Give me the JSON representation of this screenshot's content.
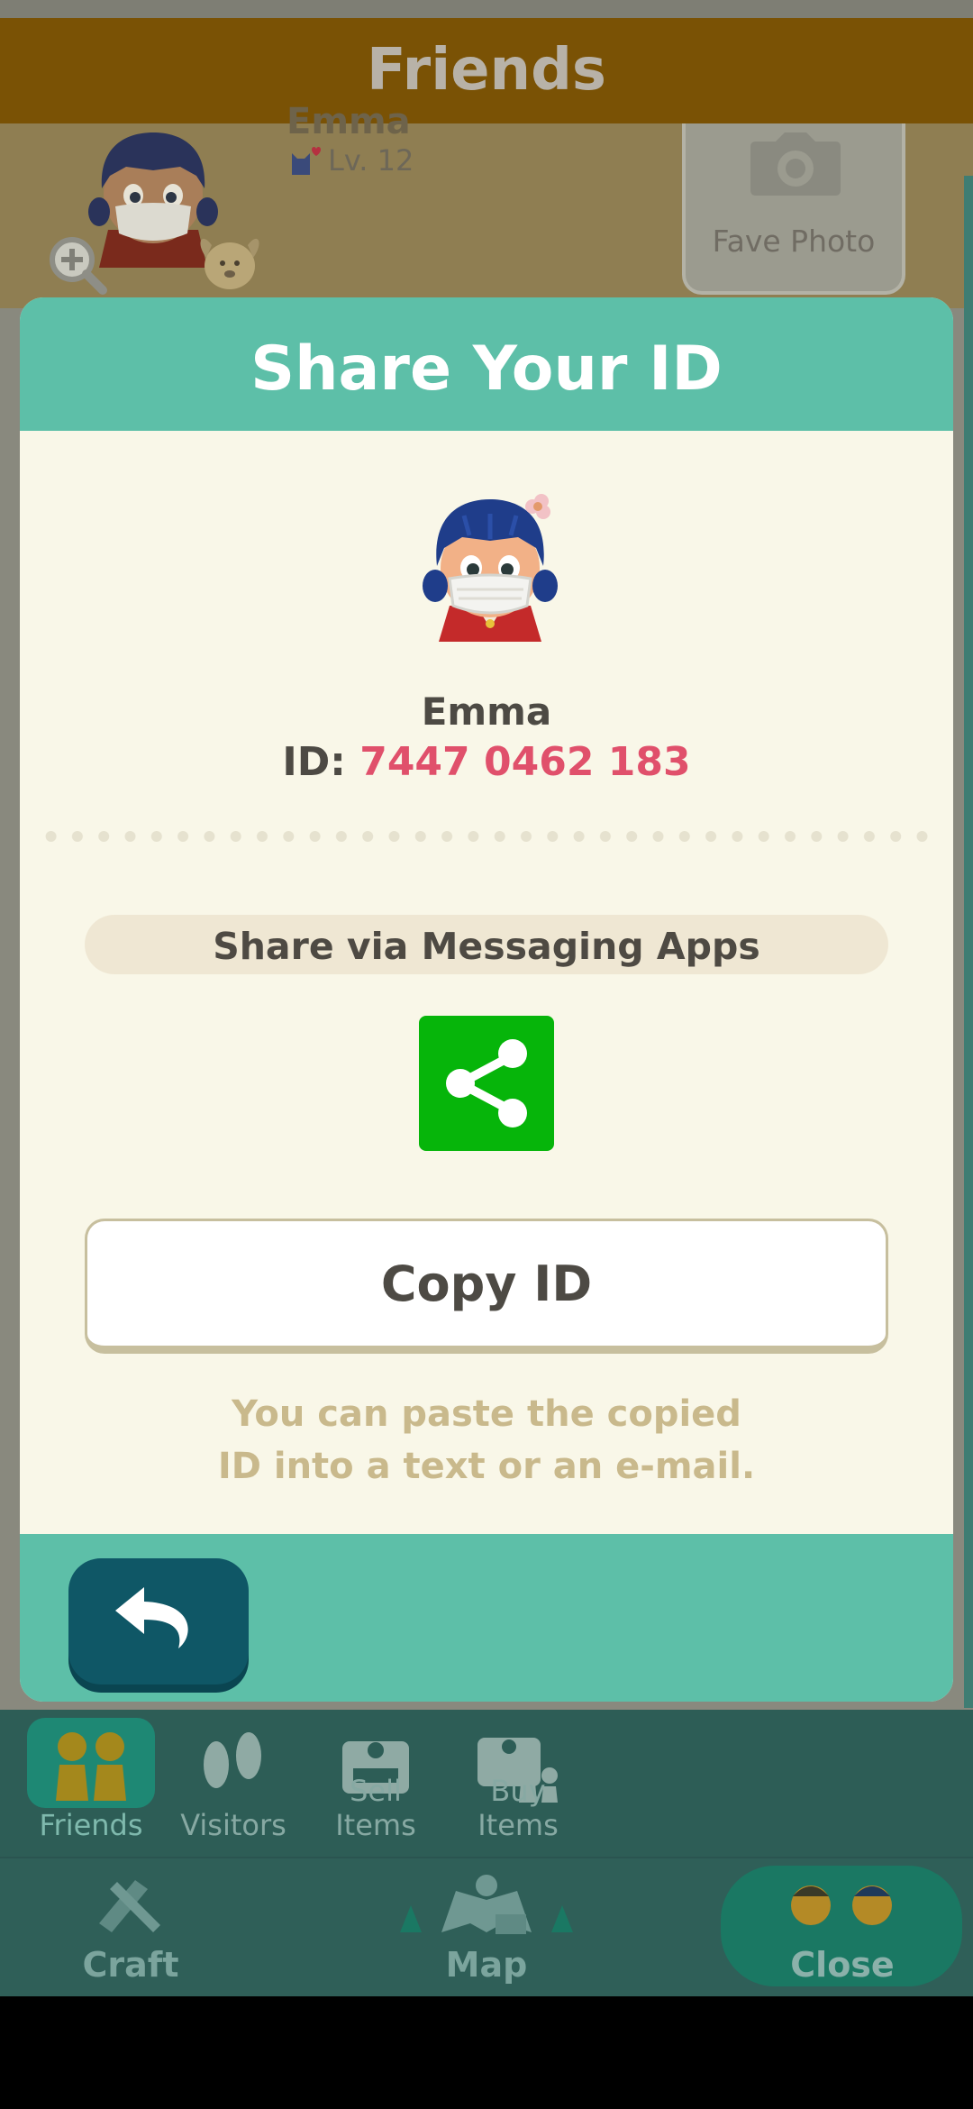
{
  "header": {
    "title": "Friends"
  },
  "profile": {
    "name": "Emma",
    "level": "Lv. 12",
    "fave_photo_label": "Fave Photo"
  },
  "modal": {
    "title": "Share Your ID",
    "user_name": "Emma",
    "id_prefix": "ID:",
    "id_value": "7447 0462 183",
    "share_label": "Share via Messaging Apps",
    "copy_label": "Copy ID",
    "hint_line1": "You can paste the copied",
    "hint_line2": "ID into a text or an e-mail."
  },
  "bottom_nav": {
    "row1": [
      {
        "label": "Friends",
        "icon": "friends-icon",
        "active": true
      },
      {
        "label": "Visitors",
        "icon": "footprints-icon",
        "active": false
      },
      {
        "label": "Sell Items",
        "icon": "sell-box-icon",
        "active": false
      },
      {
        "label": "Buy Items",
        "icon": "buy-box-icon",
        "active": false
      }
    ],
    "row2": [
      {
        "label": "Craft",
        "icon": "saw-hammer-icon"
      },
      {
        "label": "Map",
        "icon": "map-icon"
      },
      {
        "label": "Close",
        "icon": "villagers-icon"
      }
    ]
  },
  "colors": {
    "teal": "#5dbfa8",
    "cream": "#f9f7e8",
    "id_red": "#e0506b",
    "share_green": "#06b50a",
    "back_button": "#0f5766"
  }
}
